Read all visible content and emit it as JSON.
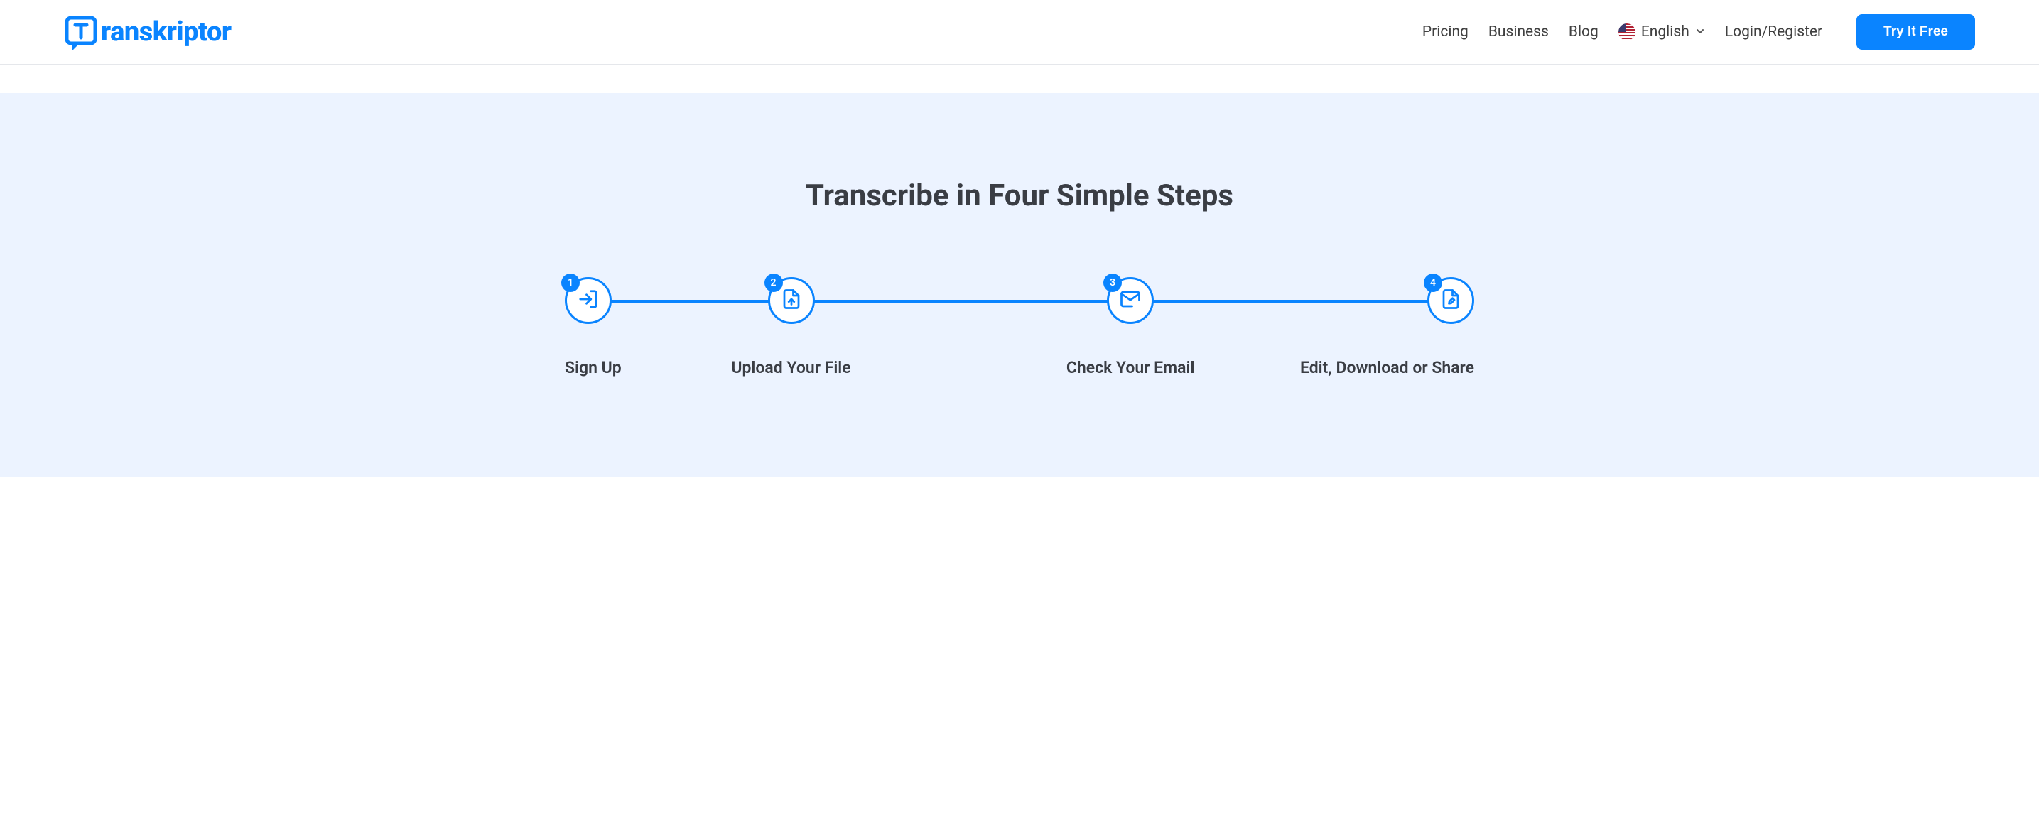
{
  "header": {
    "logo_text": "ranskriptor",
    "nav": {
      "pricing": "Pricing",
      "business": "Business",
      "blog": "Blog",
      "language": "English",
      "login": "Login/Register"
    },
    "cta": "Try It Free"
  },
  "section": {
    "title": "Transcribe in Four Simple Steps",
    "steps": [
      {
        "num": "1",
        "label": "Sign Up"
      },
      {
        "num": "2",
        "label": "Upload Your File"
      },
      {
        "num": "3",
        "label": "Check Your Email"
      },
      {
        "num": "4",
        "label": "Edit, Download or Share"
      }
    ]
  }
}
